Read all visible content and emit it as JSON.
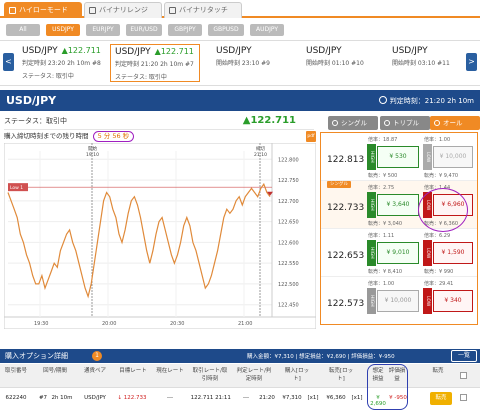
{
  "top_tabs": [
    "ハイローモード",
    "バイナリレンジ",
    "バイナリタッチ"
  ],
  "pairs": [
    "All",
    "USDJPY",
    "EURJPY",
    "EUR/USD",
    "GBPJPY",
    "GBPUSD",
    "AUDJPY"
  ],
  "carousel": {
    "prev": "<",
    "next": ">",
    "cards": [
      {
        "pair": "USD/JPY",
        "price": "122.711",
        "line2": "判定時刻 23:20 2h 10m #8",
        "line3": "ステータス: 取引中"
      },
      {
        "pair": "USD/JPY",
        "price": "122.711",
        "line2": "判定時刻 21:20 2h 10m #7",
        "line3": "ステータス: 取引中"
      },
      {
        "pair": "USD/JPY",
        "price": "",
        "line2": "開始時刻 23:10 #9",
        "line3": ""
      },
      {
        "pair": "USD/JPY",
        "price": "",
        "line2": "開始時刻 01:10 #10",
        "line3": ""
      },
      {
        "pair": "USD/JPY",
        "price": "",
        "line2": "開始時刻 03:10 #11",
        "line3": ""
      }
    ]
  },
  "header": {
    "title": "USD/JPY",
    "limit": "判定時刻：21:20 2h 10m"
  },
  "status": {
    "label": "ステータス：取引中",
    "price": "122.711",
    "timer_label": "購入締切時刻までの残り時間",
    "countdown": "5 分 56 秒",
    "pdf": "pdf"
  },
  "option_tabs": [
    "シングル",
    "トリプル",
    "オール"
  ],
  "options": [
    {
      "strike": "122.813",
      "hi_top": "倍率：18.87",
      "lo_top": "倍率：1.00",
      "high": "¥ 530",
      "low": "¥ 10,000",
      "hi_bot": "転売：¥ 500",
      "lo_bot": "転売：¥ 9,470",
      "single": ""
    },
    {
      "strike": "122.733",
      "hi_top": "倍率：2.75",
      "lo_top": "倍率：1.44",
      "high": "¥ 3,640",
      "low": "¥ 6,960",
      "hi_bot": "転売：¥ 3,040",
      "lo_bot": "転売：¥ 6,360",
      "single": "シングル"
    },
    {
      "strike": "122.653",
      "hi_top": "倍率：1.11",
      "lo_top": "倍率：6.29",
      "high": "¥ 9,010",
      "low": "¥ 1,590",
      "hi_bot": "転売：¥ 8,410",
      "lo_bot": "転売：¥ 990",
      "single": ""
    },
    {
      "strike": "122.573",
      "hi_top": "倍率：1.00",
      "lo_top": "倍率：29.41",
      "high": "¥ 10,000",
      "low": "¥ 340",
      "hi_bot": "",
      "lo_bot": "",
      "single": ""
    }
  ],
  "chart_data": {
    "type": "line",
    "title": "",
    "x_ticks": [
      "19:30",
      "20:00",
      "20:30",
      "21:00"
    ],
    "y_ticks": [
      "122.800",
      "122.750",
      "122.700",
      "122.650",
      "122.600",
      "122.550",
      "122.500",
      "122.450"
    ],
    "ylim": [
      122.43,
      122.82
    ],
    "markers": [
      {
        "label": "開始",
        "time": "19:10"
      },
      {
        "label": "締切",
        "time": "21:10"
      }
    ],
    "low_label": "Low 1",
    "values": [
      122.72,
      122.7,
      122.68,
      122.66,
      122.62,
      122.6,
      122.57,
      122.55,
      122.52,
      122.5,
      122.5,
      122.52,
      122.49,
      122.51,
      122.53,
      122.55,
      122.54,
      122.58,
      122.6,
      122.62,
      122.63,
      122.6,
      122.58,
      122.55,
      122.52,
      122.49,
      122.47,
      122.5,
      122.55,
      122.6,
      122.65,
      122.7,
      122.72,
      122.71,
      122.68,
      122.66,
      122.62,
      122.6,
      122.63,
      122.67,
      122.7,
      122.71,
      122.69,
      122.66,
      122.62,
      122.58,
      122.55,
      122.58,
      122.62,
      122.65,
      122.66,
      122.63,
      122.6,
      122.57,
      122.55,
      122.57,
      122.6,
      122.64,
      122.66,
      122.64,
      122.6,
      122.58,
      122.55,
      122.52,
      122.49,
      122.5,
      122.52,
      122.55,
      122.58,
      122.62,
      122.66,
      122.68,
      122.67,
      122.68,
      122.7,
      122.71,
      122.69,
      122.71,
      122.72,
      122.73,
      122.72,
      122.71,
      122.73,
      122.74,
      122.72,
      122.71
    ]
  },
  "bottom": {
    "title": "購入オプション詳細",
    "count": "1",
    "summary": "購入金額：¥7,310  |  想定損益：¥2,690  |  評価損益：¥-950",
    "all": "一覧",
    "headers": [
      "取引番号",
      "回号/期間",
      "通貨ペア",
      "目標レート",
      "現在レート",
      "取引レート/取引時刻",
      "判定レート/判定時刻",
      "購入[ロット]",
      "転売[ロット]",
      "想定損益",
      "評価損益",
      "転売",
      ""
    ],
    "row": [
      "622240",
      "#7",
      "2h 10m",
      "USD/JPY",
      "↓ 122.733",
      "---",
      "122.711",
      "21:11",
      "---",
      "21:20",
      "¥7,310",
      "[x1]",
      "¥6,360",
      "[x1]",
      "¥ 2,690",
      "¥ -950",
      "転売"
    ]
  }
}
